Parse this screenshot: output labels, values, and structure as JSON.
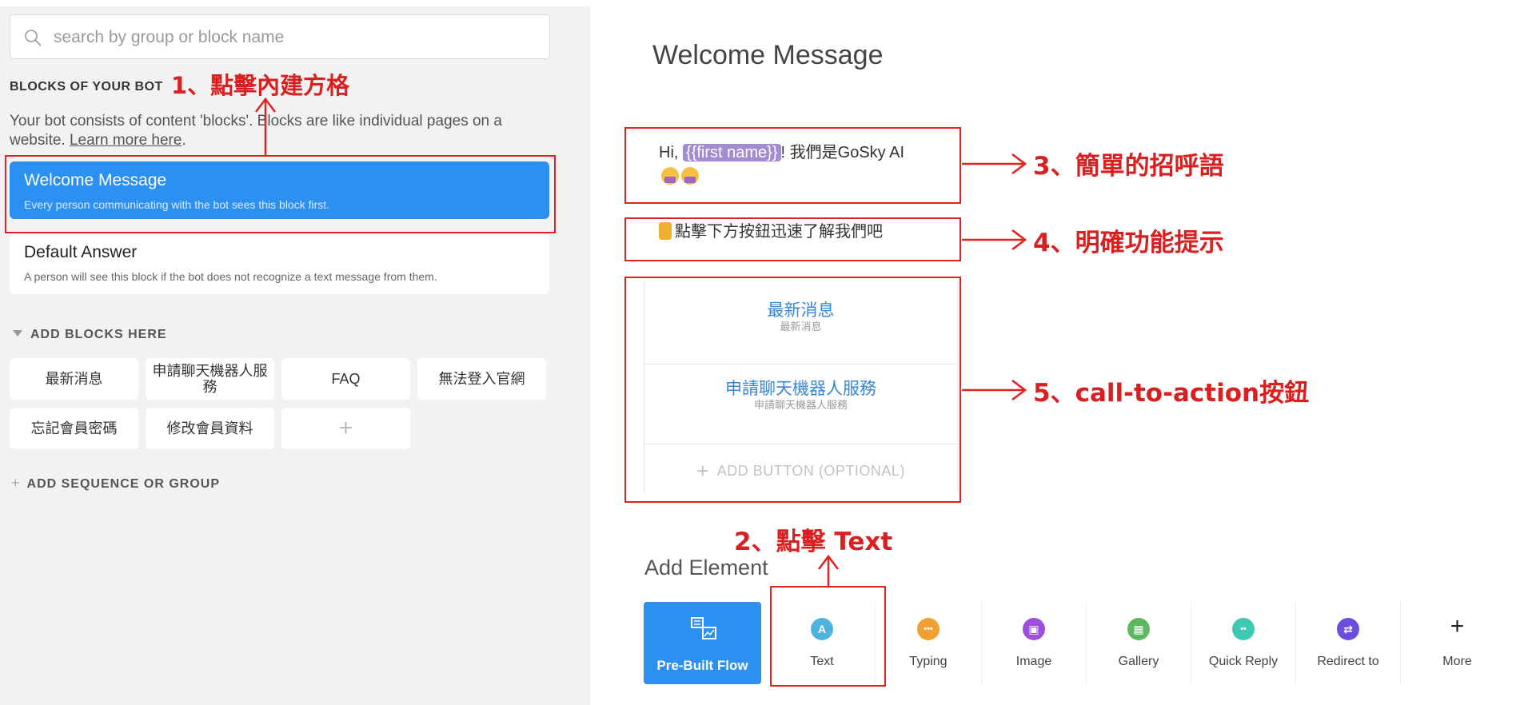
{
  "search": {
    "placeholder": "search by group or block name"
  },
  "sidebar": {
    "blocks_heading": "BLOCKS OF YOUR BOT",
    "description_text": "Your bot consists of content 'blocks'. Blocks are like individual pages on a website.",
    "learn_more": "Learn more here",
    "blocks": [
      {
        "title": "Welcome Message",
        "subtitle": "Every person communicating with the bot sees this block first."
      },
      {
        "title": "Default Answer",
        "subtitle": "A person will see this block if the bot does not recognize a text message from them."
      }
    ],
    "add_blocks_heading": "ADD BLOCKS HERE",
    "chips": [
      "最新消息",
      "申請聊天機器人服務",
      "FAQ",
      "無法登入官網",
      "忘記會員密碼",
      "修改會員資料"
    ],
    "add_chip": "+",
    "add_sequence": "ADD SEQUENCE OR GROUP",
    "add_sequence_icon": "+"
  },
  "editor": {
    "title": "Welcome Message",
    "text1": {
      "prefix": "Hi,",
      "tag": "{{first name}}",
      "suffix": "! 我們是GoSky AI"
    },
    "text2": "點擊下方按鈕迅速了解我們吧",
    "buttons": [
      {
        "label": "最新消息",
        "sublabel": "最新消息"
      },
      {
        "label": "申請聊天機器人服務",
        "sublabel": "申請聊天機器人服務"
      }
    ],
    "add_button": "ADD BUTTON (OPTIONAL)",
    "add_button_icon": "+",
    "add_element": "Add Element"
  },
  "toolbar": {
    "prebuilt": "Pre-Built Flow",
    "items": [
      {
        "label": "Text",
        "glyph": "A",
        "color": "#4fb3e0"
      },
      {
        "label": "Typing",
        "glyph": "•••",
        "color": "#f0a030"
      },
      {
        "label": "Image",
        "glyph": "▣",
        "color": "#9b4fdc"
      },
      {
        "label": "Gallery",
        "glyph": "▦",
        "color": "#5cb85c"
      },
      {
        "label": "Quick Reply",
        "glyph": "••",
        "color": "#3cc9b0"
      },
      {
        "label": "Redirect to",
        "glyph": "⇄",
        "color": "#6b4fdc"
      },
      {
        "label": "More",
        "glyph": "+",
        "color": "#222222"
      }
    ]
  },
  "annotations": {
    "a1": "1、點擊內建方格",
    "a2": "2、點擊 Text",
    "a3": "3、簡單的招呼語",
    "a4": "4、明確功能提示",
    "a5": "5、call-to-action按鈕",
    "color": "#e52020"
  }
}
